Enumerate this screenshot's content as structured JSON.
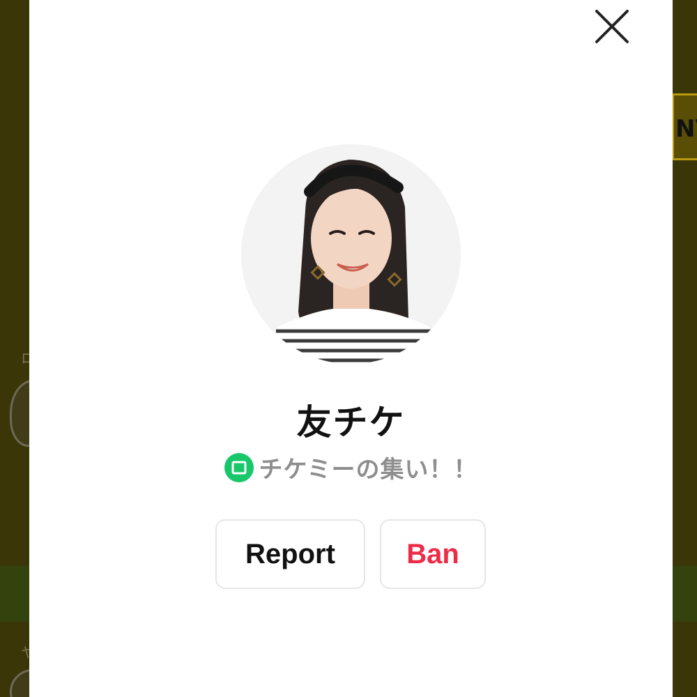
{
  "background": {
    "right_button_label": "NV",
    "text_1": "ロ",
    "text_2": "ヤ"
  },
  "profile": {
    "name": "友チケ",
    "community_name": "チケミーの集い！！",
    "community_icon": "community-chat-icon"
  },
  "actions": {
    "report_label": "Report",
    "ban_label": "Ban"
  },
  "colors": {
    "ban": "#ee2b47",
    "community_icon": "#17c76a",
    "backdrop": "#3a3608"
  }
}
